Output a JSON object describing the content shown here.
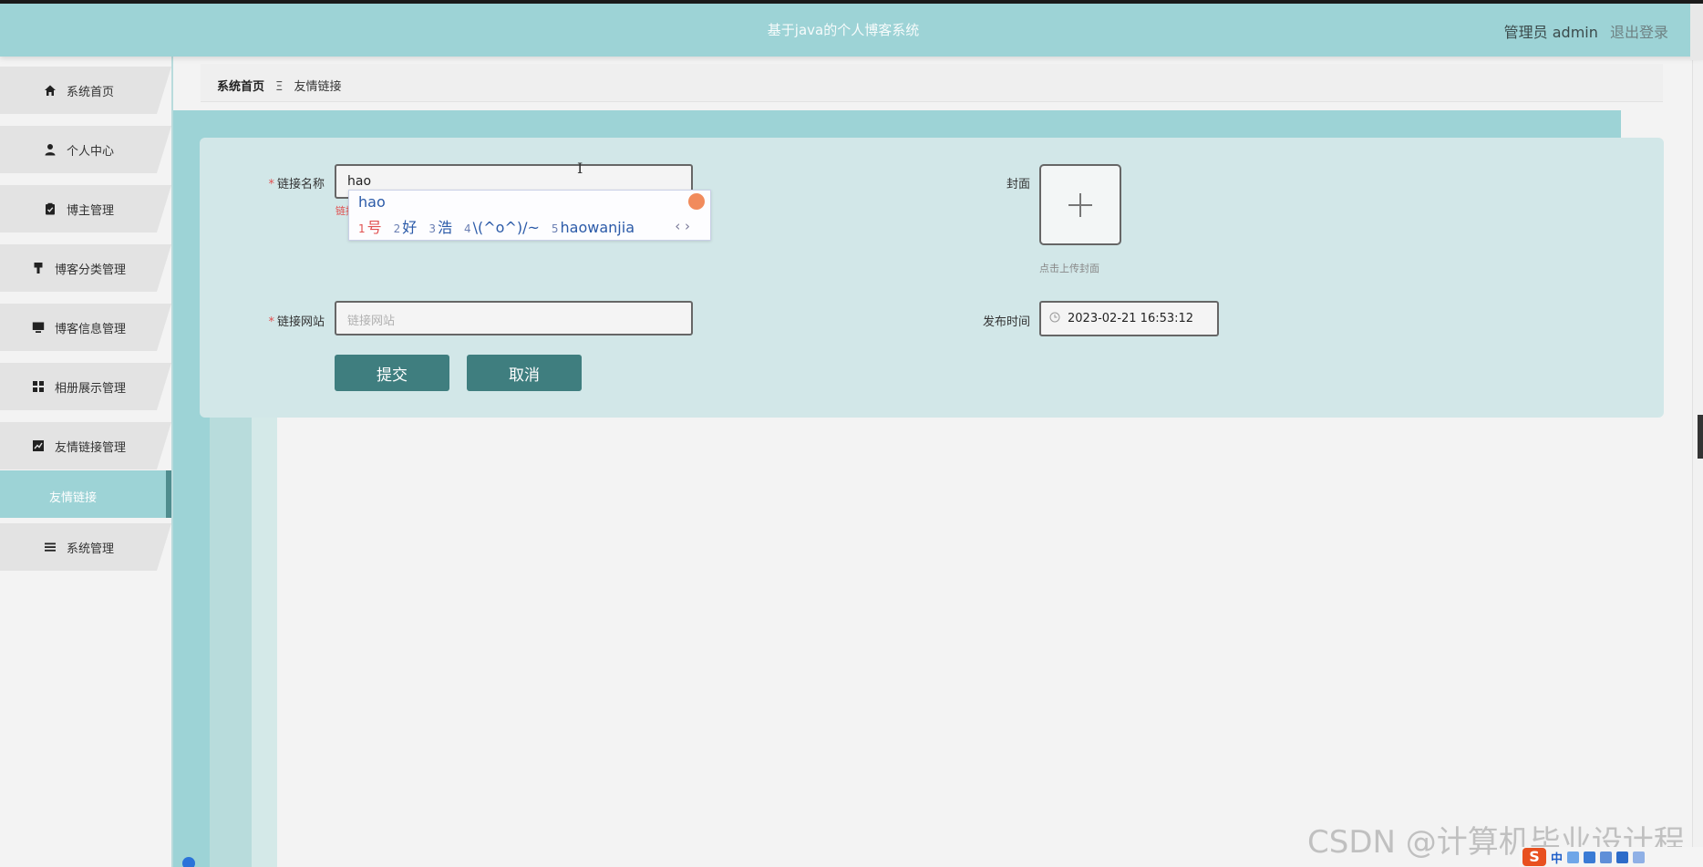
{
  "header": {
    "title": "基于java的个人博客系统",
    "user": "管理员 admin",
    "logout": "退出登录"
  },
  "sidebar": {
    "items": [
      {
        "label": "系统首页",
        "icon": "home-icon"
      },
      {
        "label": "个人中心",
        "icon": "user-icon"
      },
      {
        "label": "博主管理",
        "icon": "clipboard-icon"
      },
      {
        "label": "博客分类管理",
        "icon": "brush-icon"
      },
      {
        "label": "博客信息管理",
        "icon": "monitor-icon"
      },
      {
        "label": "相册展示管理",
        "icon": "grid-icon"
      },
      {
        "label": "友情链接管理",
        "icon": "chart-icon"
      },
      {
        "label": "系统管理",
        "icon": "menu-icon"
      }
    ],
    "active_sub": "友情链接"
  },
  "breadcrumb": {
    "home": "系统首页",
    "separator": "Ξ",
    "current": "友情链接"
  },
  "form": {
    "name_label": "链接名称",
    "name_value": "hao",
    "name_error": "链接",
    "url_label": "链接网站",
    "url_placeholder": "链接网站",
    "cover_label": "封面",
    "cover_hint": "点击上传封面",
    "time_label": "发布时间",
    "time_value": "2023-02-21 16:53:12",
    "submit": "提交",
    "cancel": "取消"
  },
  "ime": {
    "composition": "hao",
    "candidates": [
      {
        "n": "1",
        "text": "号"
      },
      {
        "n": "2",
        "text": "好"
      },
      {
        "n": "3",
        "text": "浩"
      },
      {
        "n": "4",
        "text": "\\(^o^)/~"
      },
      {
        "n": "5",
        "text": "haowanjia"
      }
    ],
    "nav": "‹ ›"
  },
  "watermark": "CSDN @计算机毕业设计程",
  "tray": {
    "logo": "S",
    "lang": "中"
  },
  "colors": {
    "accent": "#9dd3d6",
    "button": "#3f7e7f",
    "required": "#e15050"
  }
}
